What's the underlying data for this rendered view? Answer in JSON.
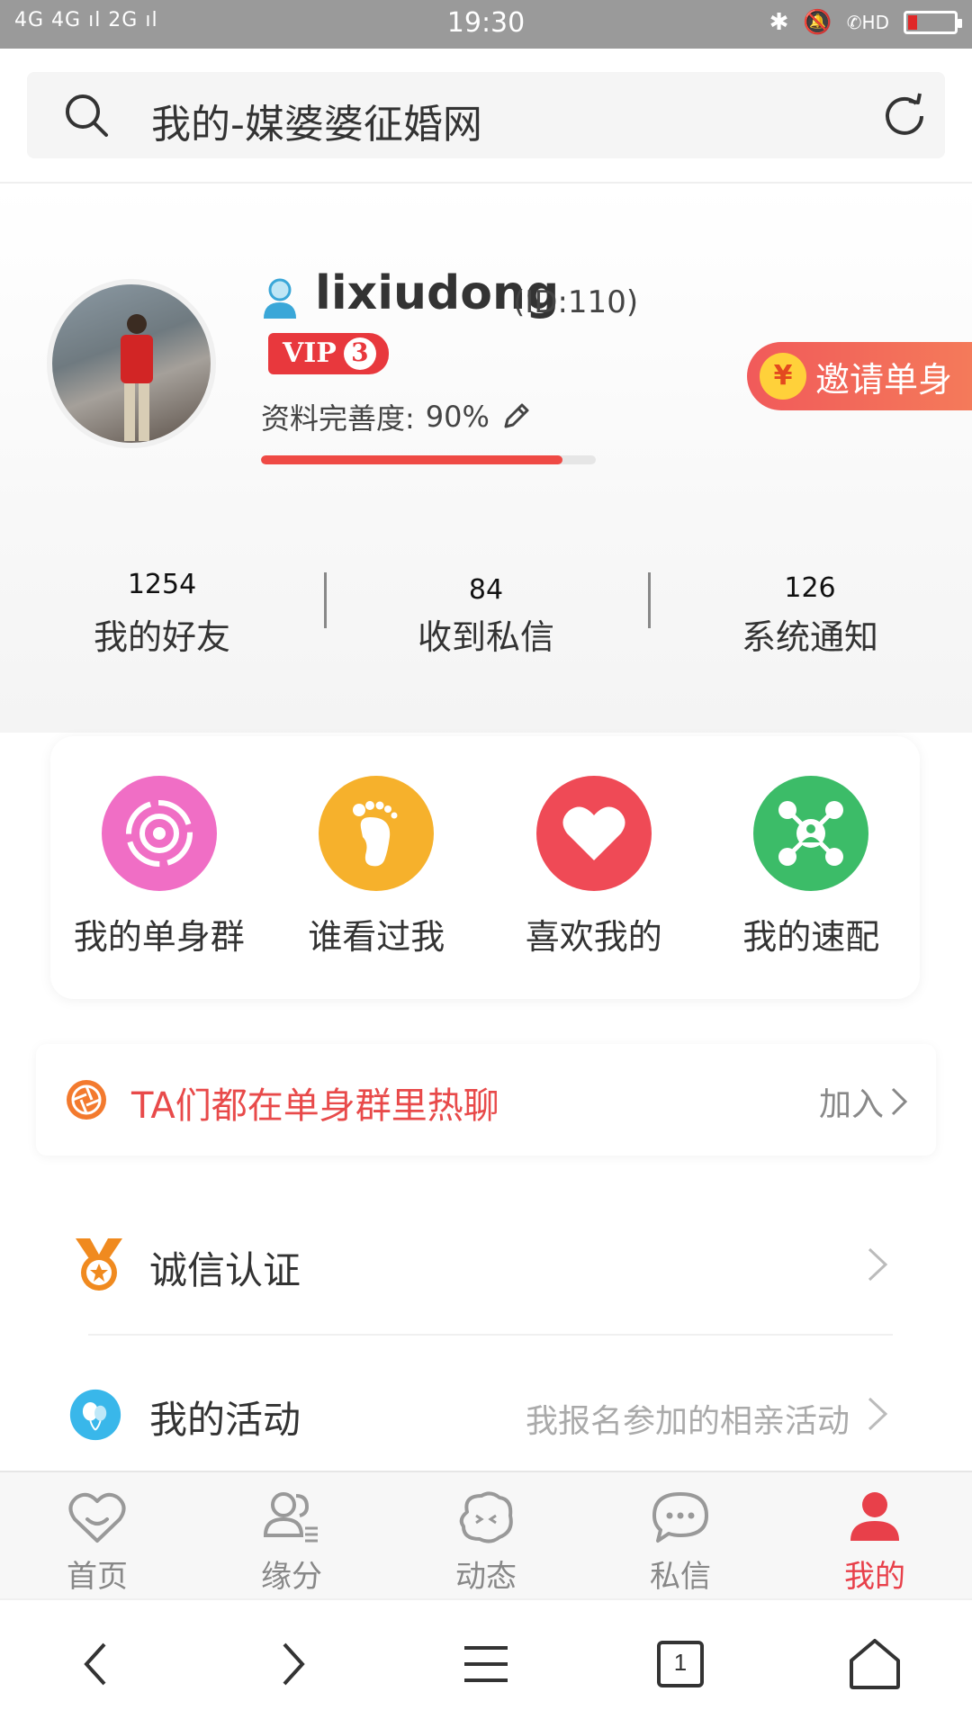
{
  "status_bar": {
    "left": "4G 4G ıl 2G ıl",
    "time": "19:30",
    "hd": "HD"
  },
  "address_bar": {
    "title": "我的-媒婆婆征婚网"
  },
  "profile": {
    "username": "lixiudong",
    "user_id": "(ID:110)",
    "vip_label": "VIP",
    "vip_level": "3",
    "completeness_label": "资料完善度:",
    "completeness_value": "90%",
    "completeness_fraction": 0.9,
    "invite_symbol": "¥",
    "invite_label": "邀请单身"
  },
  "stats": [
    {
      "value": "1254",
      "label": "我的好友"
    },
    {
      "value": "84",
      "label": "收到私信"
    },
    {
      "value": "126",
      "label": "系统通知"
    }
  ],
  "quick_actions": [
    {
      "label": "我的单身群",
      "icon": "target-icon",
      "color": "#f06ec5"
    },
    {
      "label": "谁看过我",
      "icon": "footprint-icon",
      "color": "#f6b12c"
    },
    {
      "label": "喜欢我的",
      "icon": "heart-icon",
      "color": "#ef4a56"
    },
    {
      "label": "我的速配",
      "icon": "network-icon",
      "color": "#3cbc68"
    }
  ],
  "banner": {
    "text": "TA们都在单身群里热聊",
    "action": "加入"
  },
  "menu": [
    {
      "label": "诚信认证",
      "sub": "",
      "icon": "medal-icon"
    },
    {
      "label": "我的活动",
      "sub": "我报名参加的相亲活动",
      "icon": "balloon-icon"
    }
  ],
  "tabs": [
    {
      "label": "首页",
      "icon": "heart-smile-icon"
    },
    {
      "label": "缘分",
      "icon": "people-icon"
    },
    {
      "label": "动态",
      "icon": "face-bubble-icon"
    },
    {
      "label": "私信",
      "icon": "chat-icon"
    },
    {
      "label": "我的",
      "icon": "user-icon",
      "active": true
    }
  ],
  "browser_nav": {
    "tab_count": "1"
  },
  "colors": {
    "accent": "#e8404a",
    "banner_text": "#e84a4a",
    "status_bar": "#9a9a9a"
  }
}
